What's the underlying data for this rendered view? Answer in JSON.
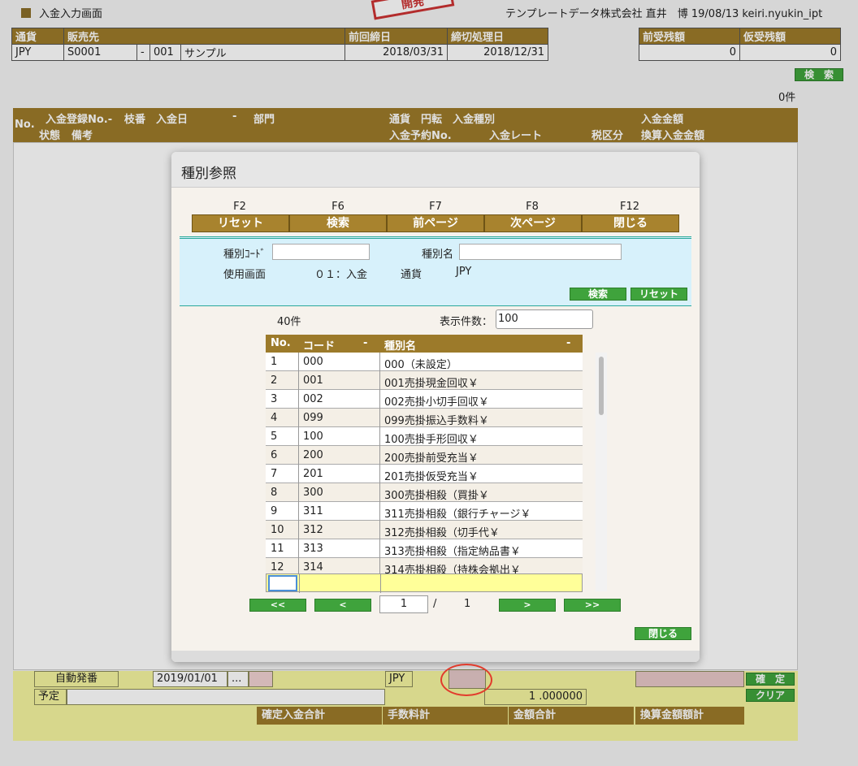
{
  "screen": {
    "title": "入金入力画面",
    "company_info": "テンプレートデータ株式会社 直井　博 19/08/13 keiri.nyukin_ipt",
    "stamp": "開発"
  },
  "header": {
    "cols": [
      "通貨",
      "販売先",
      "前回締日",
      "締切処理日"
    ],
    "currency": "JPY",
    "customer_code": "S0001",
    "customer_sep": "-",
    "customer_branch": "001",
    "customer_name": "サンプル",
    "prev_close": "2018/03/31",
    "close_date": "2018/12/31"
  },
  "balances": {
    "cols": [
      "前受残額",
      "仮受残額"
    ],
    "advance": "0",
    "suspense": "0"
  },
  "search_button": "検　索",
  "result_count": "0件",
  "list_header": {
    "no": "No.",
    "entry_no": "入金登録No.-",
    "branch": "枝番",
    "date": "入金日",
    "dash": "-",
    "dept": "部門",
    "currency": "通貨",
    "yen": "円転",
    "type": "入金種別",
    "amount": "入金金額",
    "status": "状態",
    "remarks": "備考",
    "plan_no": "入金予約No.",
    "rate": "入金レート",
    "tax": "税区分",
    "conv_amount": "換算入金金額"
  },
  "footer": {
    "auto_number": "自動発番",
    "date": "2019/01/01",
    "ellipsis": "...",
    "currency": "JPY",
    "plan": "予定",
    "rate": "1 .000000",
    "confirm_btn": "確　定",
    "clear_btn": "クリア",
    "sum_labels": [
      "確定入金合計",
      "手数料計",
      "金額合計",
      "換算金額額計"
    ]
  },
  "modal": {
    "title": "種別参照",
    "fkeys": [
      {
        "key": "F2",
        "label": "リセット"
      },
      {
        "key": "F6",
        "label": "検索"
      },
      {
        "key": "F7",
        "label": "前ページ"
      },
      {
        "key": "F8",
        "label": "次ページ"
      },
      {
        "key": "F12",
        "label": "閉じる"
      }
    ],
    "search": {
      "code_label": "種別ｺｰﾄﾞ",
      "name_label": "種別名",
      "screen_label": "使用画面",
      "screen_value": "０１：入金",
      "currency_label": "通貨",
      "currency_value": "JPY",
      "search_btn": "検索",
      "reset_btn": "リセット"
    },
    "count": "40件",
    "page_size_label": "表示件数：",
    "page_size": "100",
    "grid_headers": [
      "No.",
      "コード",
      "-",
      "種別名",
      "-"
    ],
    "rows": [
      {
        "no": "1",
        "code": "000",
        "name": "000（未設定）"
      },
      {
        "no": "2",
        "code": "001",
        "name": "001売掛現金回収￥"
      },
      {
        "no": "3",
        "code": "002",
        "name": "002売掛小切手回収￥"
      },
      {
        "no": "4",
        "code": "099",
        "name": "099売掛振込手数料￥"
      },
      {
        "no": "5",
        "code": "100",
        "name": "100売掛手形回収￥"
      },
      {
        "no": "6",
        "code": "200",
        "name": "200売掛前受充当￥"
      },
      {
        "no": "7",
        "code": "201",
        "name": "201売掛仮受充当￥"
      },
      {
        "no": "8",
        "code": "300",
        "name": "300売掛相殺（買掛￥"
      },
      {
        "no": "9",
        "code": "311",
        "name": "311売掛相殺（銀行チャージ￥"
      },
      {
        "no": "10",
        "code": "312",
        "name": "312売掛相殺（切手代￥"
      },
      {
        "no": "11",
        "code": "313",
        "name": "313売掛相殺（指定納品書￥"
      },
      {
        "no": "12",
        "code": "314",
        "name": "314売掛相殺（持株会拠出￥"
      }
    ],
    "pager": {
      "first": "<<",
      "prev": "<",
      "page": "1",
      "sep": "/",
      "total": "1",
      "next": ">",
      "last": ">>"
    },
    "close_btn": "閉じる"
  }
}
